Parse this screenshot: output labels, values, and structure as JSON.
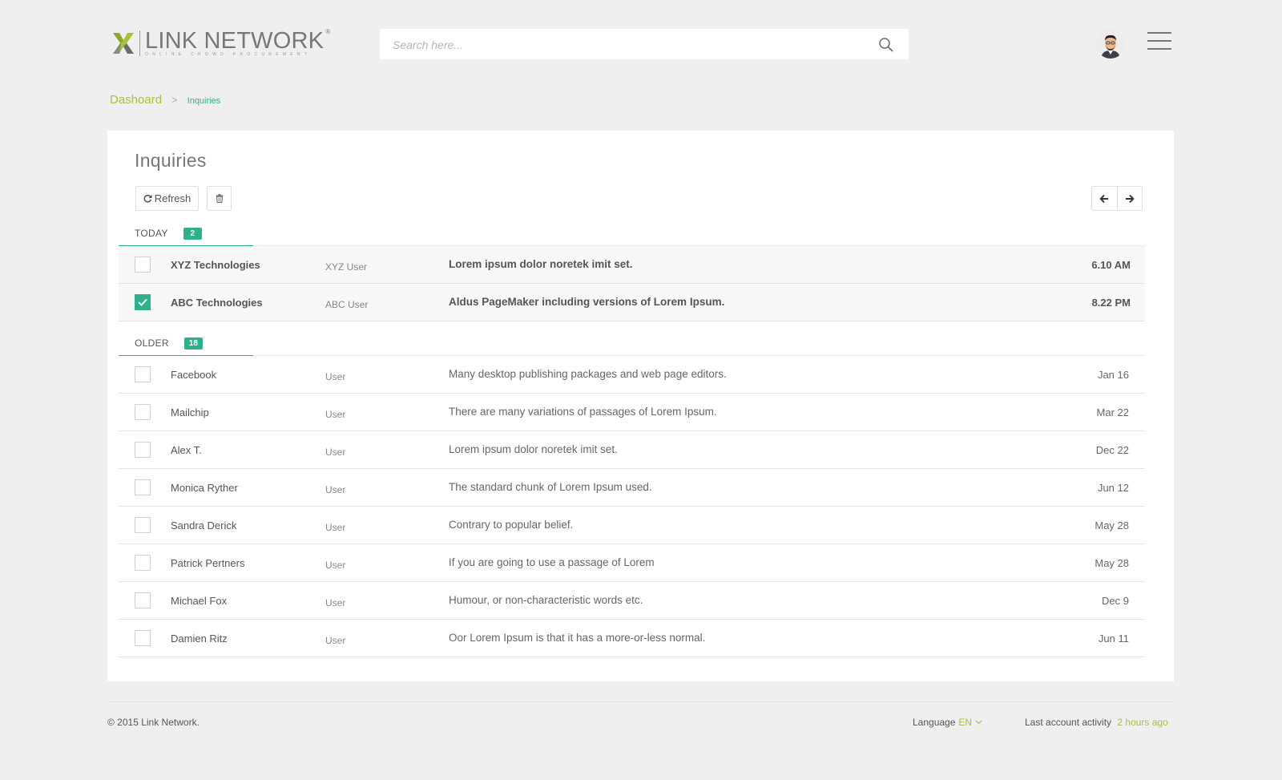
{
  "brand": {
    "name": "LINK NETWORK",
    "registered": "®",
    "tagline": "ONLINE CROWD PROCUREMENT",
    "accent_color": "#a7c23a",
    "teal_color": "#2fb08d"
  },
  "search": {
    "placeholder": "Search here...",
    "icon": "search-icon"
  },
  "header": {
    "avatar": "avatar",
    "menu_icon": "hamburger-menu-icon"
  },
  "breadcrumb": {
    "home": "Dashoard",
    "separator": ">",
    "current": "Inquiries"
  },
  "main": {
    "title": "Inquiries",
    "refresh_label": "Refresh",
    "today": {
      "label": "TODAY",
      "count": "2",
      "rows": [
        {
          "company": "XYZ Technologies",
          "user": "XYZ User",
          "subject": "Lorem ipsum dolor noretek imit set.",
          "date": "6.10 AM",
          "checked": false
        },
        {
          "company": "ABC Technologies",
          "user": "ABC User",
          "subject": "Aldus PageMaker including versions of Lorem Ipsum.",
          "date": "8.22 PM",
          "checked": true
        }
      ]
    },
    "older": {
      "label": "OLDER",
      "count": "18",
      "rows": [
        {
          "company": "Facebook",
          "user": "User",
          "subject": "Many desktop publishing packages and web page editors.",
          "date": "Jan 16",
          "checked": false
        },
        {
          "company": "Mailchip",
          "user": "User",
          "subject": "There are many variations of passages of Lorem Ipsum.",
          "date": "Mar 22",
          "checked": false
        },
        {
          "company": "Alex T.",
          "user": "User",
          "subject": "Lorem ipsum dolor noretek imit set.",
          "date": "Dec 22",
          "checked": false
        },
        {
          "company": "Monica Ryther",
          "user": "User",
          "subject": "The standard chunk of Lorem Ipsum used.",
          "date": "Jun 12",
          "checked": false
        },
        {
          "company": "Sandra Derick",
          "user": "User",
          "subject": "Contrary to popular belief.",
          "date": "May 28",
          "checked": false
        },
        {
          "company": "Patrick Pertners",
          "user": "User",
          "subject": "If you are going to use a passage of Lorem",
          "date": "May 28",
          "checked": false
        },
        {
          "company": "Michael Fox",
          "user": "User",
          "subject": "Humour, or non-characteristic words etc.",
          "date": "Dec 9",
          "checked": false
        },
        {
          "company": "Damien Ritz",
          "user": "User",
          "subject": "Oor Lorem Ipsum is that it has a more-or-less normal.",
          "date": "Jun 11",
          "checked": false
        }
      ]
    }
  },
  "footer": {
    "copyright": "© 2015 Link Network.",
    "language_label": "Language",
    "language_value": "EN",
    "activity_label": "Last account activity",
    "activity_value": "2 hours ago"
  }
}
